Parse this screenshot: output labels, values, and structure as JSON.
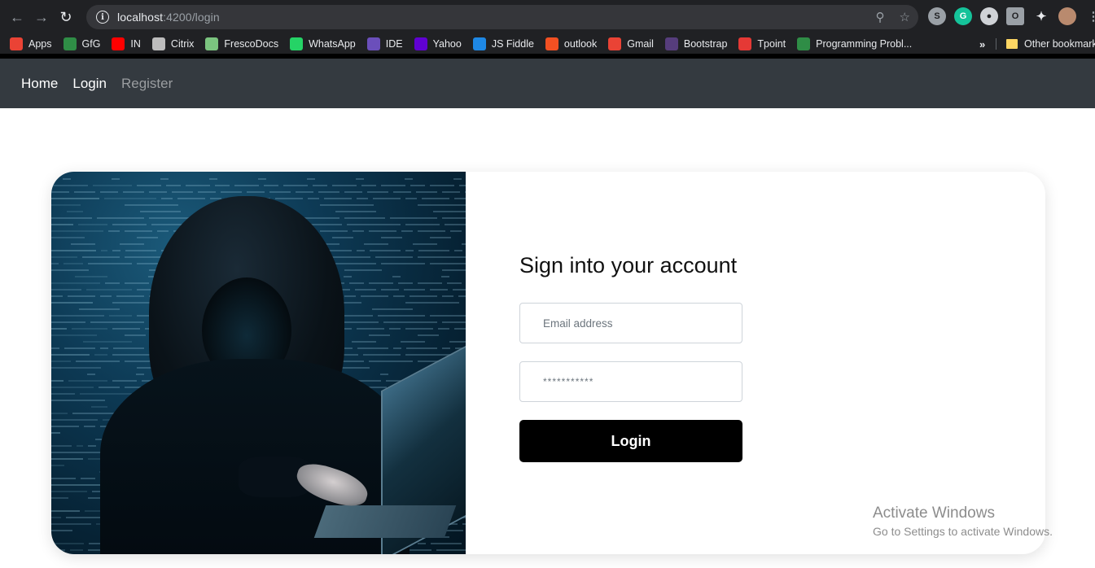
{
  "browser": {
    "url_host": "localhost",
    "url_rest": ":4200/login",
    "bookmarks": [
      {
        "label": "Apps",
        "icon": "apps-grid-icon",
        "color": "#ea4335"
      },
      {
        "label": "GfG",
        "icon": "gfg-icon",
        "color": "#2f8d46"
      },
      {
        "label": "IN",
        "icon": "youtube-icon",
        "color": "#ff0000"
      },
      {
        "label": "Citrix",
        "icon": "citrix-icon",
        "color": "#bdbdbd"
      },
      {
        "label": "FrescoDocs",
        "icon": "frescodocs-icon",
        "color": "#7bc47f"
      },
      {
        "label": "WhatsApp",
        "icon": "whatsapp-icon",
        "color": "#25d366"
      },
      {
        "label": "IDE",
        "icon": "ide-icon",
        "color": "#6b4fbb"
      },
      {
        "label": "Yahoo",
        "icon": "yahoo-icon",
        "color": "#6001d2"
      },
      {
        "label": "JS Fiddle",
        "icon": "jsfiddle-icon",
        "color": "#1e88e5"
      },
      {
        "label": "outlook",
        "icon": "microsoft-icon",
        "color": "#f25022"
      },
      {
        "label": "Gmail",
        "icon": "gmail-icon",
        "color": "#ea4335"
      },
      {
        "label": "Bootstrap",
        "icon": "bootstrap-icon",
        "color": "#563d7c"
      },
      {
        "label": "Tpoint",
        "icon": "tpoint-icon",
        "color": "#e53935"
      },
      {
        "label": "Programming Probl...",
        "icon": "gfg-icon",
        "color": "#2f8d46"
      }
    ],
    "more": "»",
    "other_bookmarks": "Other bookmarks"
  },
  "nav": {
    "home": "Home",
    "login": "Login",
    "register": "Register"
  },
  "form": {
    "title": "Sign into your account",
    "email_placeholder": "Email address",
    "password_placeholder": "***********",
    "login_button": "Login"
  },
  "watermark": {
    "line1": "Activate Windows",
    "line2": "Go to Settings to activate Windows."
  }
}
